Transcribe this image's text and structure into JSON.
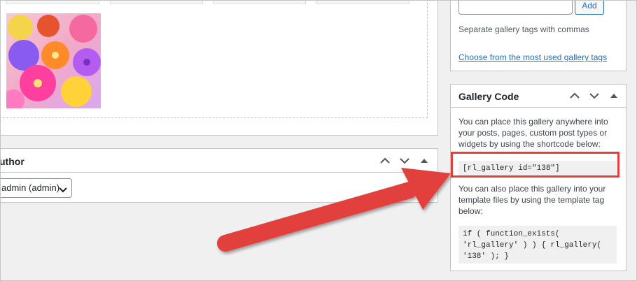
{
  "main": {
    "gallery_image_alt": "Colorful flowers",
    "author": {
      "title": "uthor",
      "selected": "admin (admin)"
    }
  },
  "sidebar": {
    "tags": {
      "add_label": "Add",
      "hint": "Separate gallery tags with commas",
      "link": "Choose from the most used gallery tags"
    },
    "gallery_code": {
      "title": "Gallery Code",
      "intro": "You can place this gallery anywhere into your posts, pages, custom post types or widgets by using the shortcode below:",
      "shortcode": "[rl_gallery id=\"138\"]",
      "template_intro": "You can also place this gallery into your template files by using the template tag below:",
      "template_code": "if ( function_exists(\n'rl_gallery' ) ) { rl_gallery(\n'138' ); }"
    }
  },
  "colors": {
    "accent": "#2271b1",
    "highlight": "#e2403c"
  },
  "icons": [
    "chevron-up-icon",
    "chevron-down-icon",
    "toggle-arrow-icon"
  ]
}
